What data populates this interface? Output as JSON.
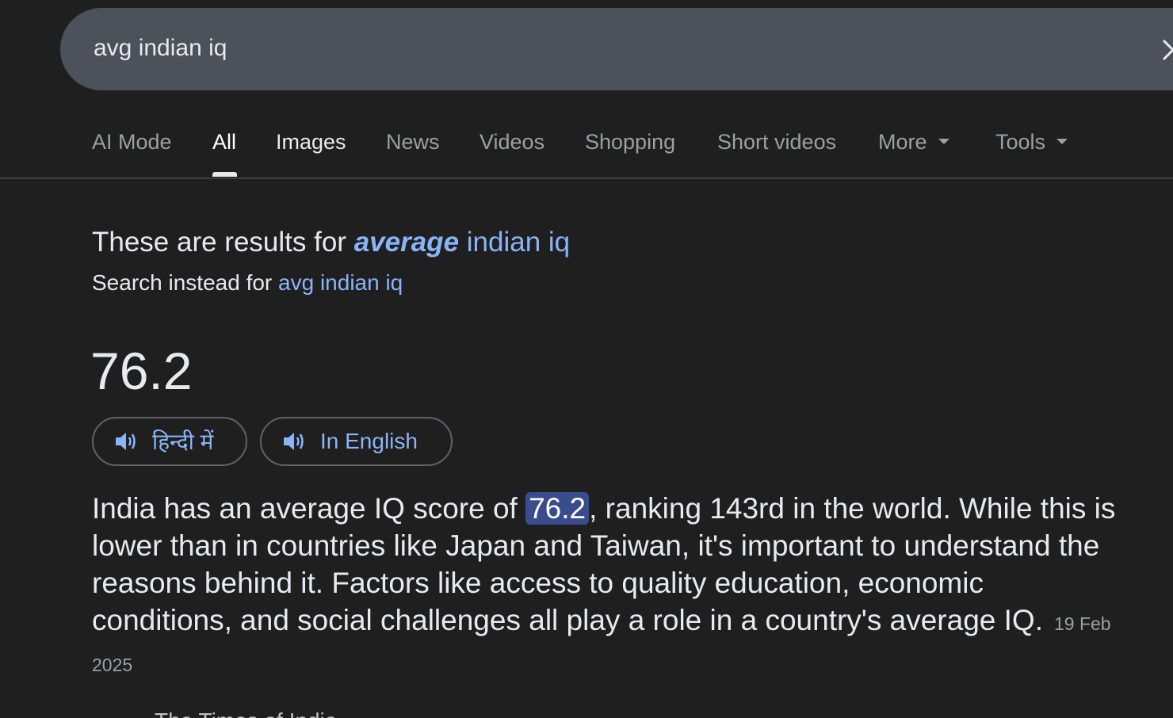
{
  "search": {
    "query": "avg indian iq"
  },
  "tabs": [
    {
      "label": "AI Mode"
    },
    {
      "label": "All"
    },
    {
      "label": "Images"
    },
    {
      "label": "News"
    },
    {
      "label": "Videos"
    },
    {
      "label": "Shopping"
    },
    {
      "label": "Short videos"
    },
    {
      "label": "More"
    },
    {
      "label": "Tools"
    }
  ],
  "active_tab": "All",
  "correction": {
    "prefix": "These are results for ",
    "corrected_bold": "average",
    "corrected_rest": " indian iq",
    "instead_prefix": "Search instead for ",
    "instead_query": "avg indian iq"
  },
  "answer": {
    "value": "76.2",
    "listen_hindi": "हिन्दी में",
    "listen_english": "In English"
  },
  "snippet": {
    "before": "India has an average IQ score of ",
    "highlight": "76.2",
    "after": ", ranking 143rd in the world. While this is lower than in countries like Japan and Taiwan, it's important to understand the reasons behind it. Factors like access to quality education, economic conditions, and social challenges all play a role in a country's average IQ.",
    "date": "19 Feb 2025"
  },
  "source_partial": "The Times of India",
  "colors": {
    "background": "#1f1f1f",
    "searchbar": "#4d5159",
    "link": "#8ab4f8",
    "highlight": "#394c8e",
    "muted": "#9aa0a6"
  }
}
